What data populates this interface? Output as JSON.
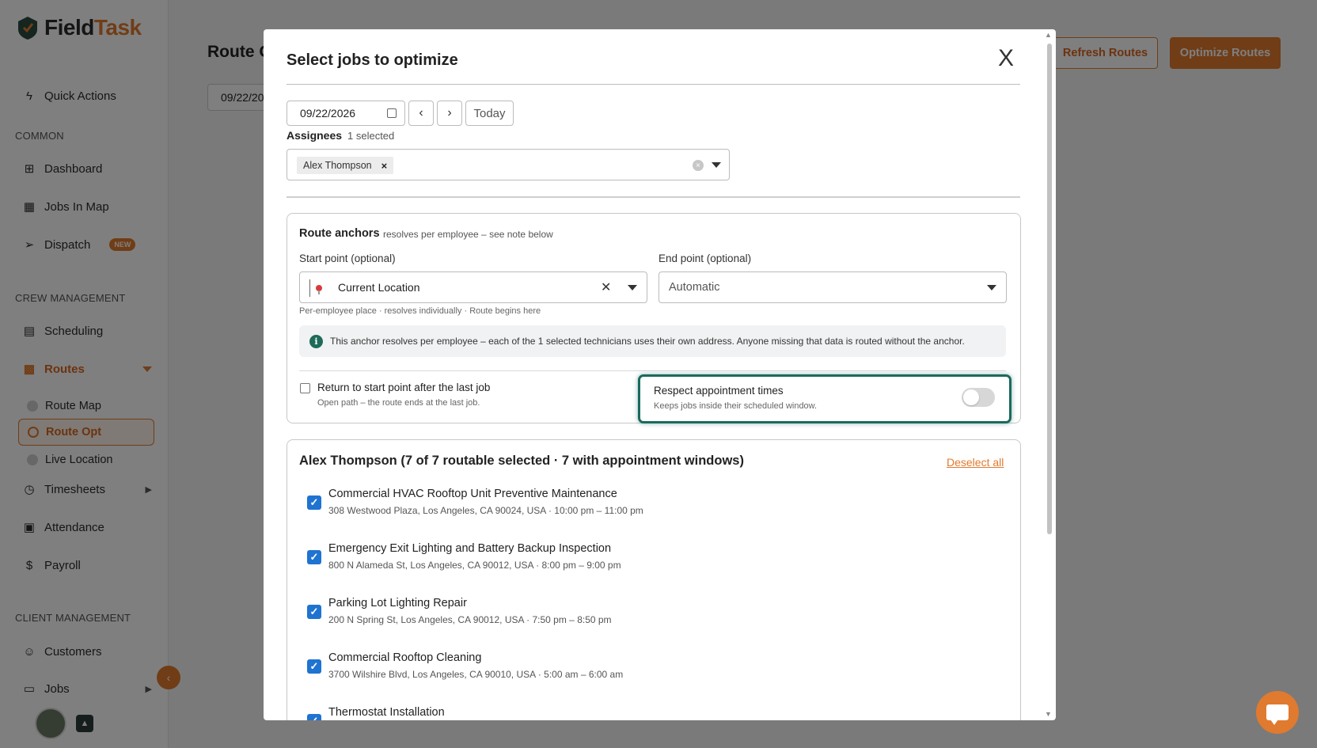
{
  "app": {
    "brand_main": "Field",
    "brand_accent": "Task"
  },
  "sidebar": {
    "quick_actions": "Quick Actions",
    "sections": {
      "common": "COMMON",
      "crew": "CREW MANAGEMENT",
      "client": "CLIENT MANAGEMENT"
    },
    "items": {
      "dashboard": "Dashboard",
      "jobs_in_map": "Jobs In Map",
      "dispatch": "Dispatch",
      "dispatch_badge": "NEW",
      "scheduling": "Scheduling",
      "routes": "Routes",
      "route_map": "Route Map",
      "route_opt": "Route Opt",
      "live_location": "Live Location",
      "timesheets": "Timesheets",
      "attendance": "Attendance",
      "payroll": "Payroll",
      "customers": "Customers",
      "jobs": "Jobs"
    }
  },
  "main": {
    "title": "Route O",
    "date": "09/22/20",
    "refresh_label": "Refresh Routes",
    "optimize_label": "Optimize Routes"
  },
  "modal": {
    "title": "Select jobs to optimize",
    "close_label": "X",
    "date": "09/22/2026",
    "today_label": "Today",
    "assignees_label": "Assignees",
    "assignees_count": "1 selected",
    "assignee_chip": "Alex Thompson",
    "anchors": {
      "title": "Route anchors",
      "note": "resolves per employee – see note below",
      "start_label": "Start point (optional)",
      "start_value": "Current Location",
      "end_label": "End point (optional)",
      "end_value": "Automatic",
      "helper": "Per-employee place · resolves individually · Route begins here",
      "info": "This anchor resolves per employee – each of the 1 selected technicians uses their own address. Anyone missing that data is routed without the anchor.",
      "return_label": "Return to start point after the last job",
      "return_sub": "Open path – the route ends at the last job.",
      "return_checked": false,
      "respect_label": "Respect appointment times",
      "respect_sub": "Keeps jobs inside their scheduled window.",
      "respect_on": false
    },
    "jobs": {
      "title": "Alex Thompson (7 of 7 routable selected · 7 with appointment windows)",
      "deselect_label": "Deselect all",
      "list": [
        {
          "title": "Commercial HVAC Rooftop Unit Preventive Maintenance",
          "meta": "308 Westwood Plaza, Los Angeles, CA 90024, USA · 10:00 pm – 11:00 pm",
          "checked": true
        },
        {
          "title": "Emergency Exit Lighting and Battery Backup Inspection",
          "meta": "800 N Alameda St, Los Angeles, CA 90012, USA · 8:00 pm – 9:00 pm",
          "checked": true
        },
        {
          "title": "Parking Lot Lighting Repair",
          "meta": "200 N Spring St, Los Angeles, CA 90012, USA · 7:50 pm – 8:50 pm",
          "checked": true
        },
        {
          "title": "Commercial Rooftop Cleaning",
          "meta": "3700 Wilshire Blvd, Los Angeles, CA 90010, USA · 5:00 am – 6:00 am",
          "checked": true
        },
        {
          "title": "Thermostat Installation",
          "meta": "",
          "checked": true
        }
      ]
    }
  },
  "colors": {
    "accent": "#e07a2f",
    "focus_ring": "#1a6a5e",
    "checkbox": "#1f73d1"
  }
}
